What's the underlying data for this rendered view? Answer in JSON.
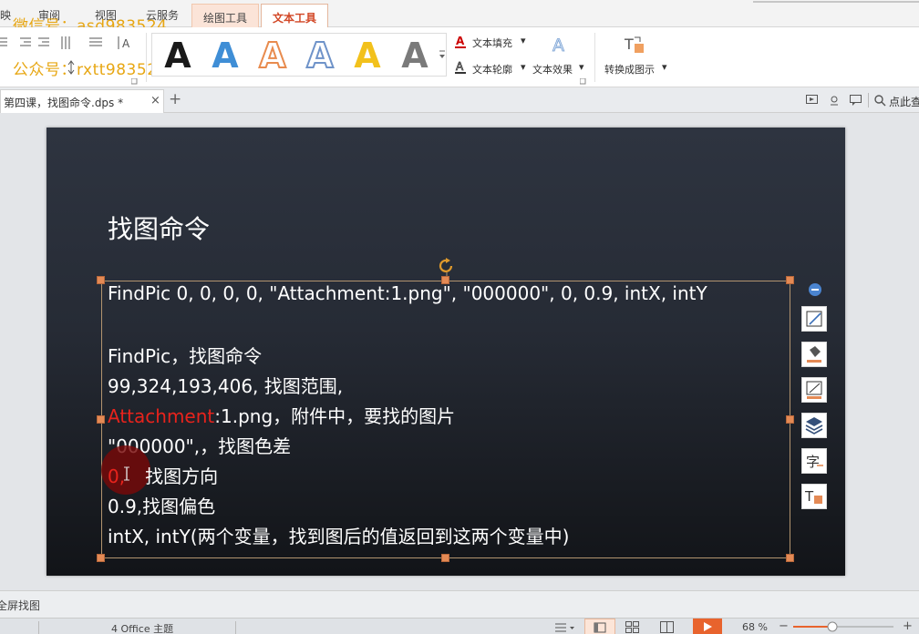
{
  "ribbon_tabs": [
    "映",
    "审阅",
    "视图",
    "云服务",
    "绘图工具",
    "文本工具"
  ],
  "watermark": {
    "line1": "微信号：asd983524",
    "line2": "公众号：rxtt983524"
  },
  "text_tools": {
    "fill": "文本填充",
    "outline": "文本轮廓",
    "effect": "文本效果",
    "convert": "转换成图示",
    "gallery_letter": "A"
  },
  "quick_right": {
    "search": "点此查"
  },
  "document_tab": {
    "name": "第四课，找图命令.dps *",
    "close": "×",
    "new": "+"
  },
  "slide": {
    "title": "找图命令",
    "lines": [
      "FindPic 0, 0, 0, 0, \"Attachment:1.png\", \"000000\", 0, 0.9, intX, intY",
      "FindPic，找图命令",
      "99,324,193,406, 找图范围,",
      "Attachment",
      ":1.png，附件中，要找的图片",
      "\"000000\",，找图色差",
      "0,",
      "找图方向",
      "0.9,找图偏色",
      "intX, intY(两个变量，找到图后的值返回到这两个变量中)"
    ]
  },
  "notes_bar": {
    "label": "全屏找图"
  },
  "status_bar": {
    "theme": "4  Office 主题",
    "zoom": "68 %",
    "zoom_level_percent": 68
  },
  "colors": {
    "accent": "#d24726",
    "red_text": "#e8231c",
    "handle": "#e48a55",
    "watermark": "#e6a000"
  }
}
